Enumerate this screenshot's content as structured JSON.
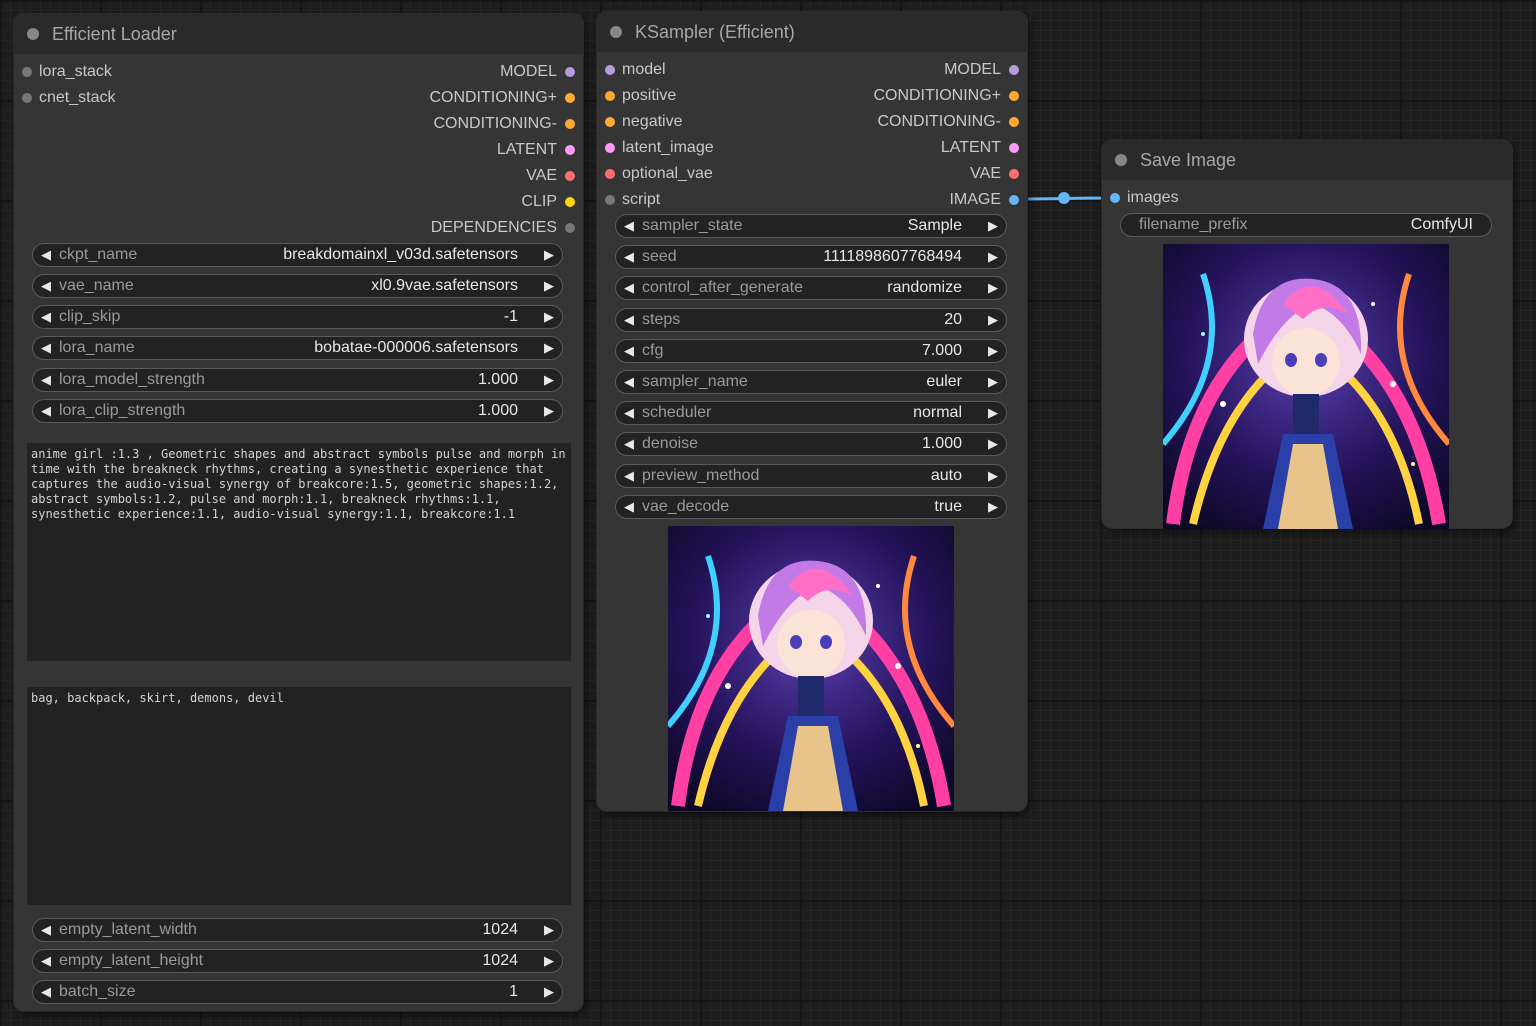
{
  "colors": {
    "model": "#b39ddb",
    "conditioning": "#ffa931",
    "latent": "#ff9cf9",
    "vae": "#ff6e6e",
    "clip": "#ffd500",
    "image": "#64b5f6",
    "generic": "#777777"
  },
  "loader": {
    "title": "Efficient Loader",
    "inputs": [
      "lora_stack",
      "cnet_stack"
    ],
    "outputs": [
      "MODEL",
      "CONDITIONING+",
      "CONDITIONING-",
      "LATENT",
      "VAE",
      "CLIP",
      "DEPENDENCIES"
    ],
    "widgets": [
      {
        "label": "ckpt_name",
        "value": "breakdomainxl_v03d.safetensors"
      },
      {
        "label": "vae_name",
        "value": "xl0.9vae.safetensors"
      },
      {
        "label": "clip_skip",
        "value": "-1"
      },
      {
        "label": "lora_name",
        "value": "bobatae-000006.safetensors"
      },
      {
        "label": "lora_model_strength",
        "value": "1.000"
      },
      {
        "label": "lora_clip_strength",
        "value": "1.000"
      }
    ],
    "positive_prompt": "anime girl :1.3 , Geometric shapes and abstract symbols pulse and morph in time with the breakneck rhythms, creating a synesthetic experience that captures the audio-visual synergy of breakcore:1.5, geometric shapes:1.2, abstract symbols:1.2, pulse and morph:1.1, breakneck rhythms:1.1, synesthetic experience:1.1, audio-visual synergy:1.1, breakcore:1.1",
    "negative_prompt": "bag, backpack, skirt, demons, devil",
    "widgets_bottom": [
      {
        "label": "empty_latent_width",
        "value": "1024"
      },
      {
        "label": "empty_latent_height",
        "value": "1024"
      },
      {
        "label": "batch_size",
        "value": "1"
      }
    ]
  },
  "sampler": {
    "title": "KSampler (Efficient)",
    "inputs": [
      "model",
      "positive",
      "negative",
      "latent_image",
      "optional_vae",
      "script"
    ],
    "outputs": [
      "MODEL",
      "CONDITIONING+",
      "CONDITIONING-",
      "LATENT",
      "VAE",
      "IMAGE"
    ],
    "widgets": [
      {
        "label": "sampler_state",
        "value": "Sample"
      },
      {
        "label": "seed",
        "value": "1111898607768494"
      },
      {
        "label": "control_after_generate",
        "value": "randomize"
      },
      {
        "label": "steps",
        "value": "20"
      },
      {
        "label": "cfg",
        "value": "7.000"
      },
      {
        "label": "sampler_name",
        "value": "euler"
      },
      {
        "label": "scheduler",
        "value": "normal"
      },
      {
        "label": "denoise",
        "value": "1.000"
      },
      {
        "label": "preview_method",
        "value": "auto"
      },
      {
        "label": "vae_decode",
        "value": "true"
      }
    ]
  },
  "save": {
    "title": "Save Image",
    "input": "images",
    "filename_label": "filename_prefix",
    "filename_value": "ComfyUI"
  }
}
